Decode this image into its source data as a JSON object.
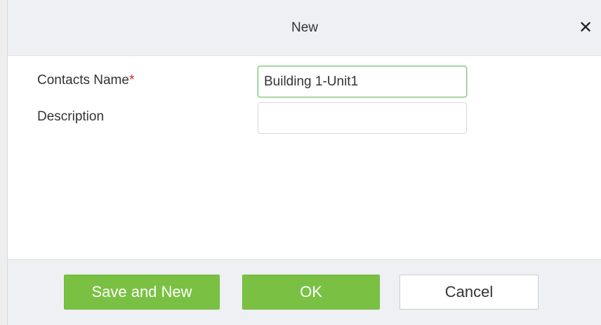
{
  "dialog": {
    "title": "New",
    "close_icon": "close-icon",
    "close_glyph": "✕"
  },
  "form": {
    "contacts_name": {
      "label": "Contacts Name",
      "required_mark": "*",
      "value": "Building 1-Unit1"
    },
    "description": {
      "label": "Description",
      "value": ""
    }
  },
  "footer": {
    "save_and_new_label": "Save and New",
    "ok_label": "OK",
    "cancel_label": "Cancel"
  },
  "colors": {
    "primary_button": "#7ac143",
    "focus_border": "#7cc576",
    "required": "#e02020",
    "header_bg": "#eef0f4"
  }
}
